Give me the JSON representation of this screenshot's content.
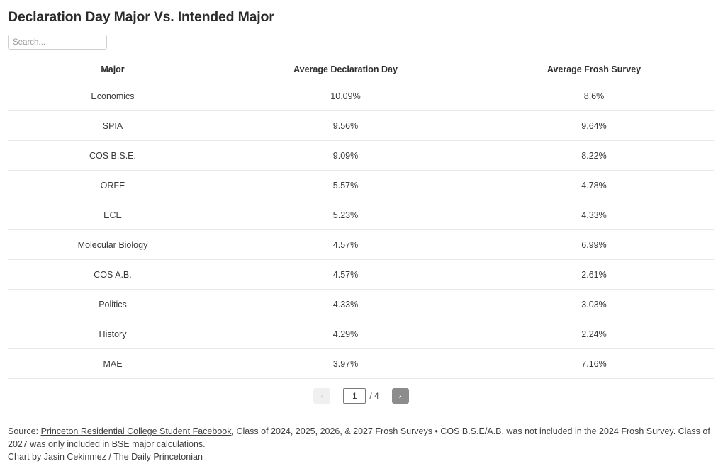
{
  "header": {
    "title": "Declaration Day Major Vs. Intended Major"
  },
  "search": {
    "placeholder": "Search...",
    "value": ""
  },
  "table": {
    "columns": [
      "Major",
      "Average Declaration Day",
      "Average Frosh Survey"
    ],
    "rows": [
      {
        "major": "Economics",
        "declaration_day": "10.09%",
        "frosh_survey": "8.6%"
      },
      {
        "major": "SPIA",
        "declaration_day": "9.56%",
        "frosh_survey": "9.64%"
      },
      {
        "major": "COS B.S.E.",
        "declaration_day": "9.09%",
        "frosh_survey": "8.22%"
      },
      {
        "major": "ORFE",
        "declaration_day": "5.57%",
        "frosh_survey": "4.78%"
      },
      {
        "major": "ECE",
        "declaration_day": "5.23%",
        "frosh_survey": "4.33%"
      },
      {
        "major": "Molecular Biology",
        "declaration_day": "4.57%",
        "frosh_survey": "6.99%"
      },
      {
        "major": "COS A.B.",
        "declaration_day": "4.57%",
        "frosh_survey": "2.61%"
      },
      {
        "major": "Politics",
        "declaration_day": "4.33%",
        "frosh_survey": "3.03%"
      },
      {
        "major": "History",
        "declaration_day": "4.29%",
        "frosh_survey": "2.24%"
      },
      {
        "major": "MAE",
        "declaration_day": "3.97%",
        "frosh_survey": "7.16%"
      }
    ]
  },
  "pagination": {
    "prev_label": "‹",
    "next_label": "›",
    "current_page": "1",
    "total_label": "/ 4"
  },
  "footnote": {
    "source_prefix": "Source: ",
    "source_link": "Princeton Residential College Student Facebook",
    "source_rest": ", Class of 2024, 2025, 2026, & 2027 Frosh Surveys • COS B.S.E/A.B. was not included in the 2024 Frosh Survey. Class of 2027 was only included in BSE major calculations.",
    "credit": "Chart by Jasin Cekinmez / The Daily Princetonian"
  },
  "chart_data": {
    "type": "table",
    "title": "Declaration Day Major Vs. Intended Major",
    "columns": [
      "Major",
      "Average Declaration Day",
      "Average Frosh Survey"
    ],
    "categories": [
      "Economics",
      "SPIA",
      "COS B.S.E.",
      "ORFE",
      "ECE",
      "Molecular Biology",
      "COS A.B.",
      "Politics",
      "History",
      "MAE"
    ],
    "series": [
      {
        "name": "Average Declaration Day",
        "values": [
          10.09,
          9.56,
          9.09,
          5.57,
          5.23,
          4.57,
          4.57,
          4.33,
          4.29,
          3.97
        ]
      },
      {
        "name": "Average Frosh Survey",
        "values": [
          8.6,
          9.64,
          8.22,
          4.78,
          4.33,
          6.99,
          2.61,
          3.03,
          2.24,
          7.16
        ]
      }
    ],
    "units": "percent",
    "page": 1,
    "total_pages": 4,
    "rows_per_page": 10
  }
}
